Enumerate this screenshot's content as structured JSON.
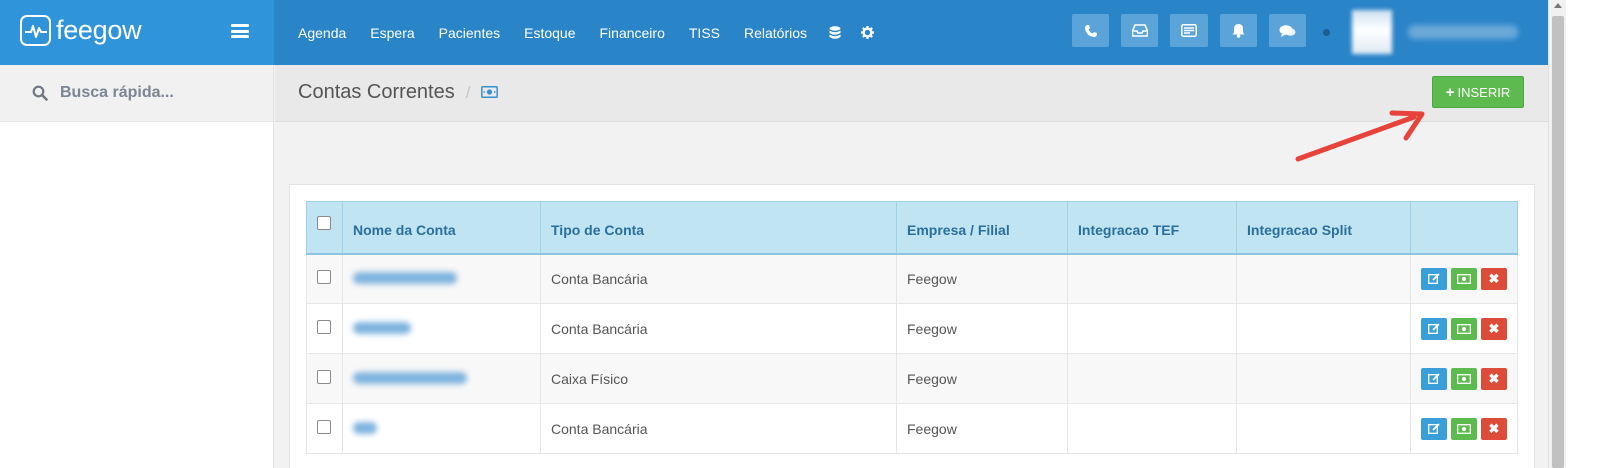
{
  "brand": {
    "name": "feegow"
  },
  "nav": {
    "items": [
      {
        "label": "Agenda"
      },
      {
        "label": "Espera"
      },
      {
        "label": "Pacientes"
      },
      {
        "label": "Estoque"
      },
      {
        "label": "Financeiro"
      },
      {
        "label": "TISS"
      },
      {
        "label": "Relatórios"
      }
    ],
    "icons": [
      "database-icon",
      "gear-icon"
    ]
  },
  "tools": [
    "phone-icon",
    "inbox-icon",
    "list-card-icon",
    "bell-icon",
    "chat-icon"
  ],
  "sidebar": {
    "search_placeholder": "Busca rápida..."
  },
  "page": {
    "title": "Contas Correntes",
    "breadcrumb_icon": "money-icon"
  },
  "toolbar": {
    "insert_label": "INSERIR"
  },
  "table": {
    "columns": [
      "Nome da Conta",
      "Tipo de Conta",
      "Empresa / Filial",
      "Integracao TEF",
      "Integracao Split"
    ],
    "rows": [
      {
        "tipo": "Conta Bancária",
        "empresa": "Feegow",
        "tef": "",
        "split": ""
      },
      {
        "tipo": "Conta Bancária",
        "empresa": "Feegow",
        "tef": "",
        "split": ""
      },
      {
        "tipo": "Caixa Físico",
        "empresa": "Feegow",
        "tef": "",
        "split": ""
      },
      {
        "tipo": "Conta Bancária",
        "empresa": "Feegow",
        "tef": "",
        "split": ""
      }
    ]
  },
  "colors": {
    "topbar": "#2a84c8",
    "logo_area": "#2f94da",
    "insert_button": "#5dba4f",
    "header_row": "#c0e4f2",
    "edit_button": "#3a9fd9",
    "delete_button": "#dd4b39",
    "annotation_arrow": "#e8433a"
  }
}
